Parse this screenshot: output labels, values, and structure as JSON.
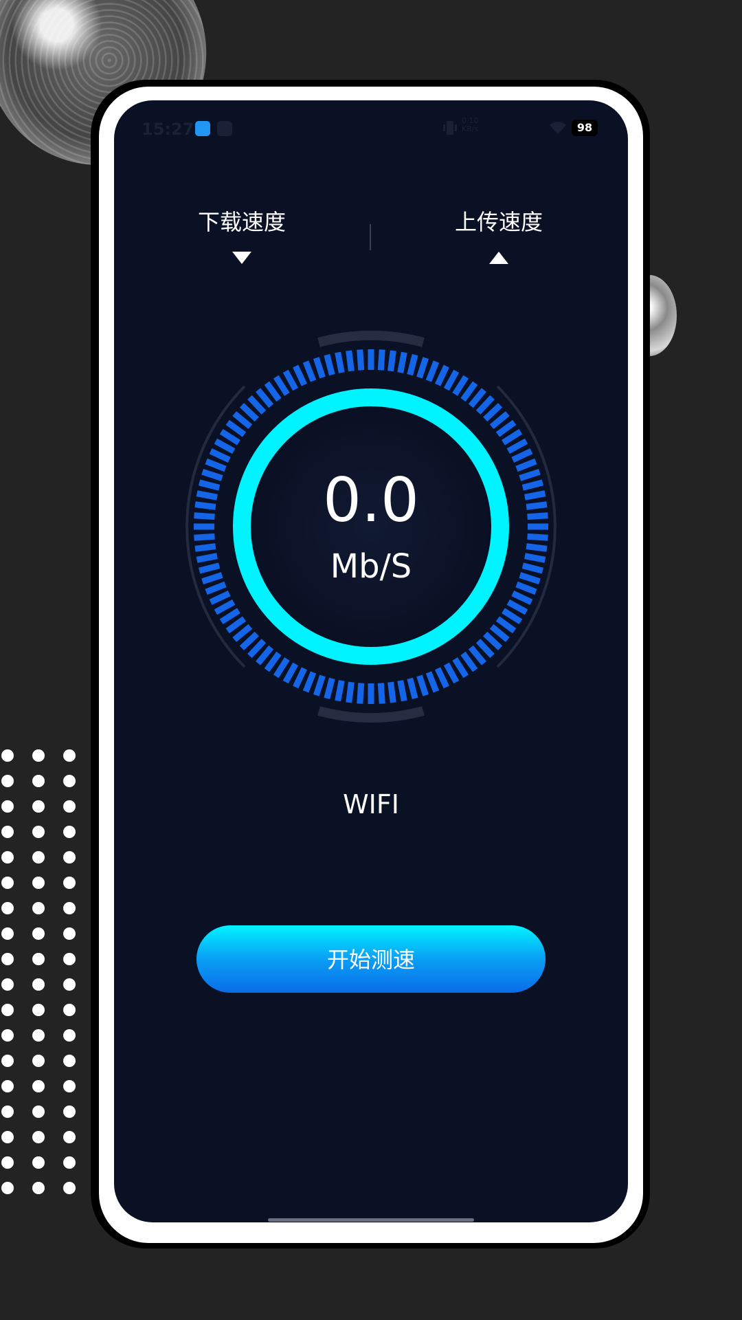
{
  "status_bar": {
    "time": "15:27",
    "net_rate_value": "0.10",
    "net_rate_unit": "KB/s",
    "battery": "98"
  },
  "tabs": {
    "download_label": "下载速度",
    "upload_label": "上传速度"
  },
  "gauge": {
    "speed_value": "0.0",
    "speed_unit": "Mb/S"
  },
  "network_type": "WIFI",
  "start_button_label": "开始测速",
  "colors": {
    "background": "#232323",
    "screen": "#0b1125",
    "ring_cyan": "#00f4ff",
    "tick_blue": "#1565e8",
    "button_top": "#00f4ff",
    "button_bottom": "#0a6de8"
  }
}
